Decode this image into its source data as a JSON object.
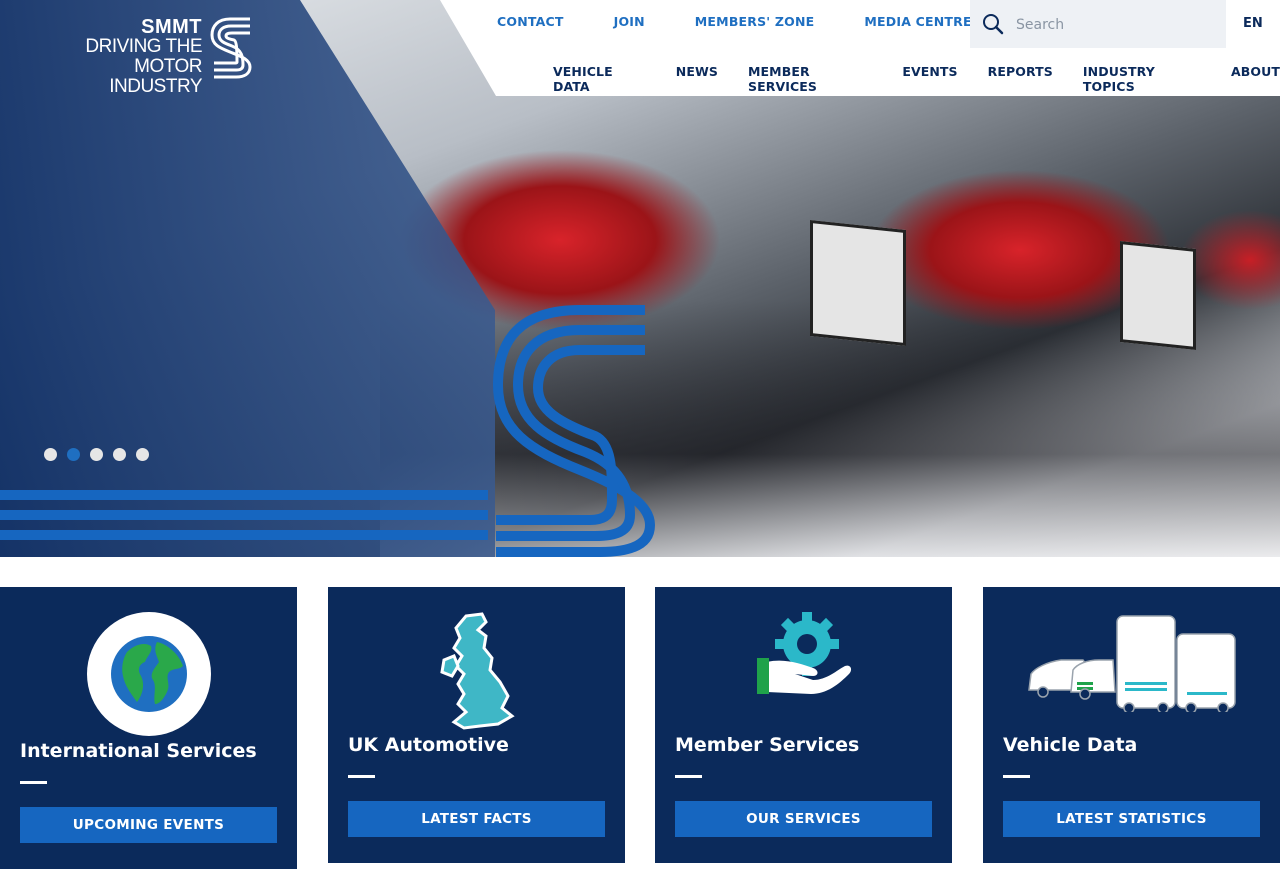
{
  "brand": {
    "line1": "SMMT",
    "line2": "DRIVING THE",
    "line3": "MOTOR INDUSTRY"
  },
  "utility_nav": [
    "CONTACT",
    "JOIN",
    "MEMBERS' ZONE",
    "MEDIA CENTRE"
  ],
  "search": {
    "placeholder": "Search"
  },
  "language": "EN",
  "main_nav": [
    "VEHICLE DATA",
    "NEWS",
    "MEMBER SERVICES",
    "EVENTS",
    "REPORTS",
    "INDUSTRY TOPICS",
    "ABOUT"
  ],
  "carousel": {
    "slide_count": 5,
    "active_index": 1
  },
  "colors": {
    "navy": "#0b2a5b",
    "blue": "#1666c0",
    "accent": "#1f6fc1",
    "teal": "#2bb8c9",
    "green": "#1fa24a"
  },
  "cards": [
    {
      "title": "International Services",
      "button": "UPCOMING EVENTS",
      "icon": "globe-icon"
    },
    {
      "title": "UK Automotive",
      "button": "LATEST FACTS",
      "icon": "uk-map-icon"
    },
    {
      "title": "Member Services",
      "button": "OUR SERVICES",
      "icon": "hand-gear-icon"
    },
    {
      "title": "Vehicle Data",
      "button": "LATEST STATISTICS",
      "icon": "vehicles-icon"
    }
  ]
}
